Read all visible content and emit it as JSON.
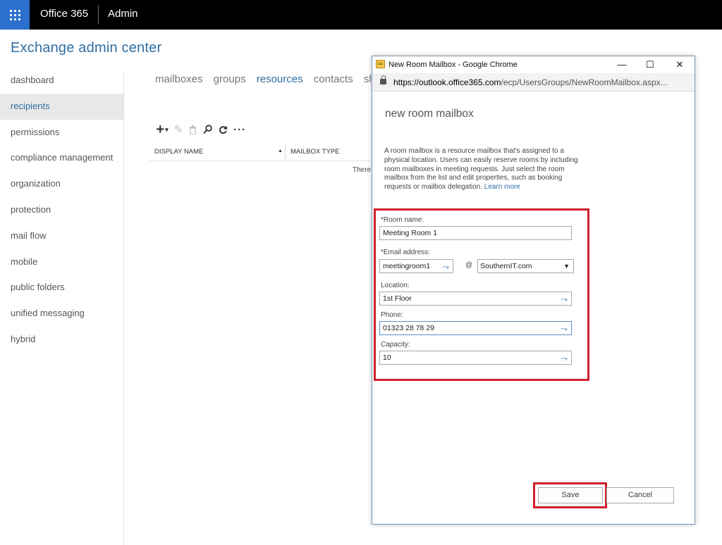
{
  "topbar": {
    "app_name": "Office 365",
    "section": "Admin"
  },
  "page_title": "Exchange admin center",
  "leftnav": {
    "items": [
      {
        "label": "dashboard"
      },
      {
        "label": "recipients"
      },
      {
        "label": "permissions"
      },
      {
        "label": "compliance management"
      },
      {
        "label": "organization"
      },
      {
        "label": "protection"
      },
      {
        "label": "mail flow"
      },
      {
        "label": "mobile"
      },
      {
        "label": "public folders"
      },
      {
        "label": "unified messaging"
      },
      {
        "label": "hybrid"
      }
    ],
    "selected": "recipients"
  },
  "tabs": [
    {
      "label": "mailboxes"
    },
    {
      "label": "groups"
    },
    {
      "label": "resources"
    },
    {
      "label": "contacts"
    },
    {
      "label": "sh"
    }
  ],
  "active_tab": "resources",
  "toolbar": {
    "add_icon": "plus-icon",
    "edit_icon": "pencil-icon",
    "delete_icon": "trash-icon",
    "search_icon": "search-icon",
    "refresh_icon": "refresh-icon",
    "more_icon": "more-icon"
  },
  "grid": {
    "columns": [
      "DISPLAY NAME",
      "MAILBOX TYPE"
    ],
    "empty_text": "There"
  },
  "popup": {
    "window_title": "New Room Mailbox - Google Chrome",
    "url_host": "https://outlook.office365.com",
    "url_path": "/ecp/UsersGroups/NewRoomMailbox.aspx...",
    "heading": "new room mailbox",
    "description": "A room mailbox is a resource mailbox that's assigned to a physical location. Users can easily reserve rooms by including room mailboxes in meeting requests. Just select the room mailbox from the list and edit properties, such as booking requests or mailbox delegation.",
    "learn_more": "Learn more",
    "fields": {
      "room_name_label": "*Room name:",
      "room_name_value": "Meeting Room 1",
      "email_label": "*Email address:",
      "email_value": "meetingroom1",
      "at": "@",
      "domain_value": "SouthernIT.com",
      "location_label": "Location:",
      "location_value": "1st Floor",
      "phone_label": "Phone:",
      "phone_value": "01323 28 78 29",
      "capacity_label": "Capacity:",
      "capacity_value": "10"
    },
    "save_label": "Save",
    "cancel_label": "Cancel"
  },
  "colors": {
    "accent": "#2f6ea4",
    "waffle": "#2b6fcf",
    "highlight": "#d11f2d"
  }
}
